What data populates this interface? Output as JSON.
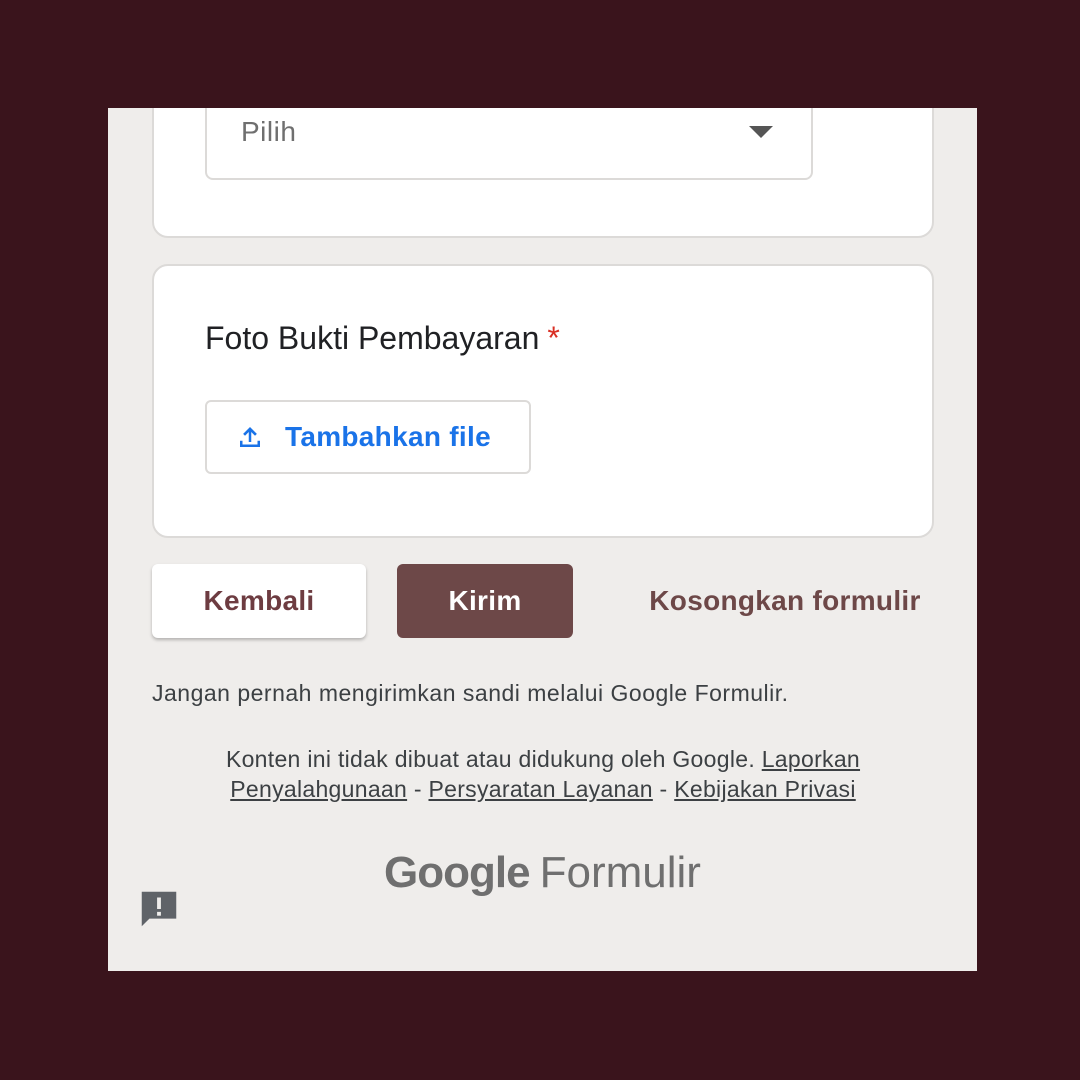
{
  "dropdown": {
    "value": "Pilih"
  },
  "upload_question": {
    "title": "Foto Bukti Pembayaran",
    "required_mark": "*",
    "add_file_label": "Tambahkan file"
  },
  "actions": {
    "back_label": "Kembali",
    "submit_label": "Kirim",
    "clear_label": "Kosongkan formulir"
  },
  "warning_text": "Jangan pernah mengirimkan sandi melalui Google Formulir.",
  "footer": {
    "disclaimer": "Konten ini tidak dibuat atau didukung oleh Google.",
    "report_link": "Laporkan Penyalahgunaan",
    "separator": "-",
    "terms_link": "Persyaratan Layanan",
    "privacy_link": "Kebijakan Privasi"
  },
  "brand": {
    "google": "Google",
    "product": "Formulir"
  },
  "icons": {
    "dropdown": "caret-down-icon",
    "upload": "upload-icon",
    "feedback": "feedback-icon"
  },
  "colors": {
    "outer_background": "#3a141c",
    "page_background": "#efedeb",
    "accent": "#6d4848",
    "link_blue": "#1a73e8",
    "required": "#d93025"
  }
}
